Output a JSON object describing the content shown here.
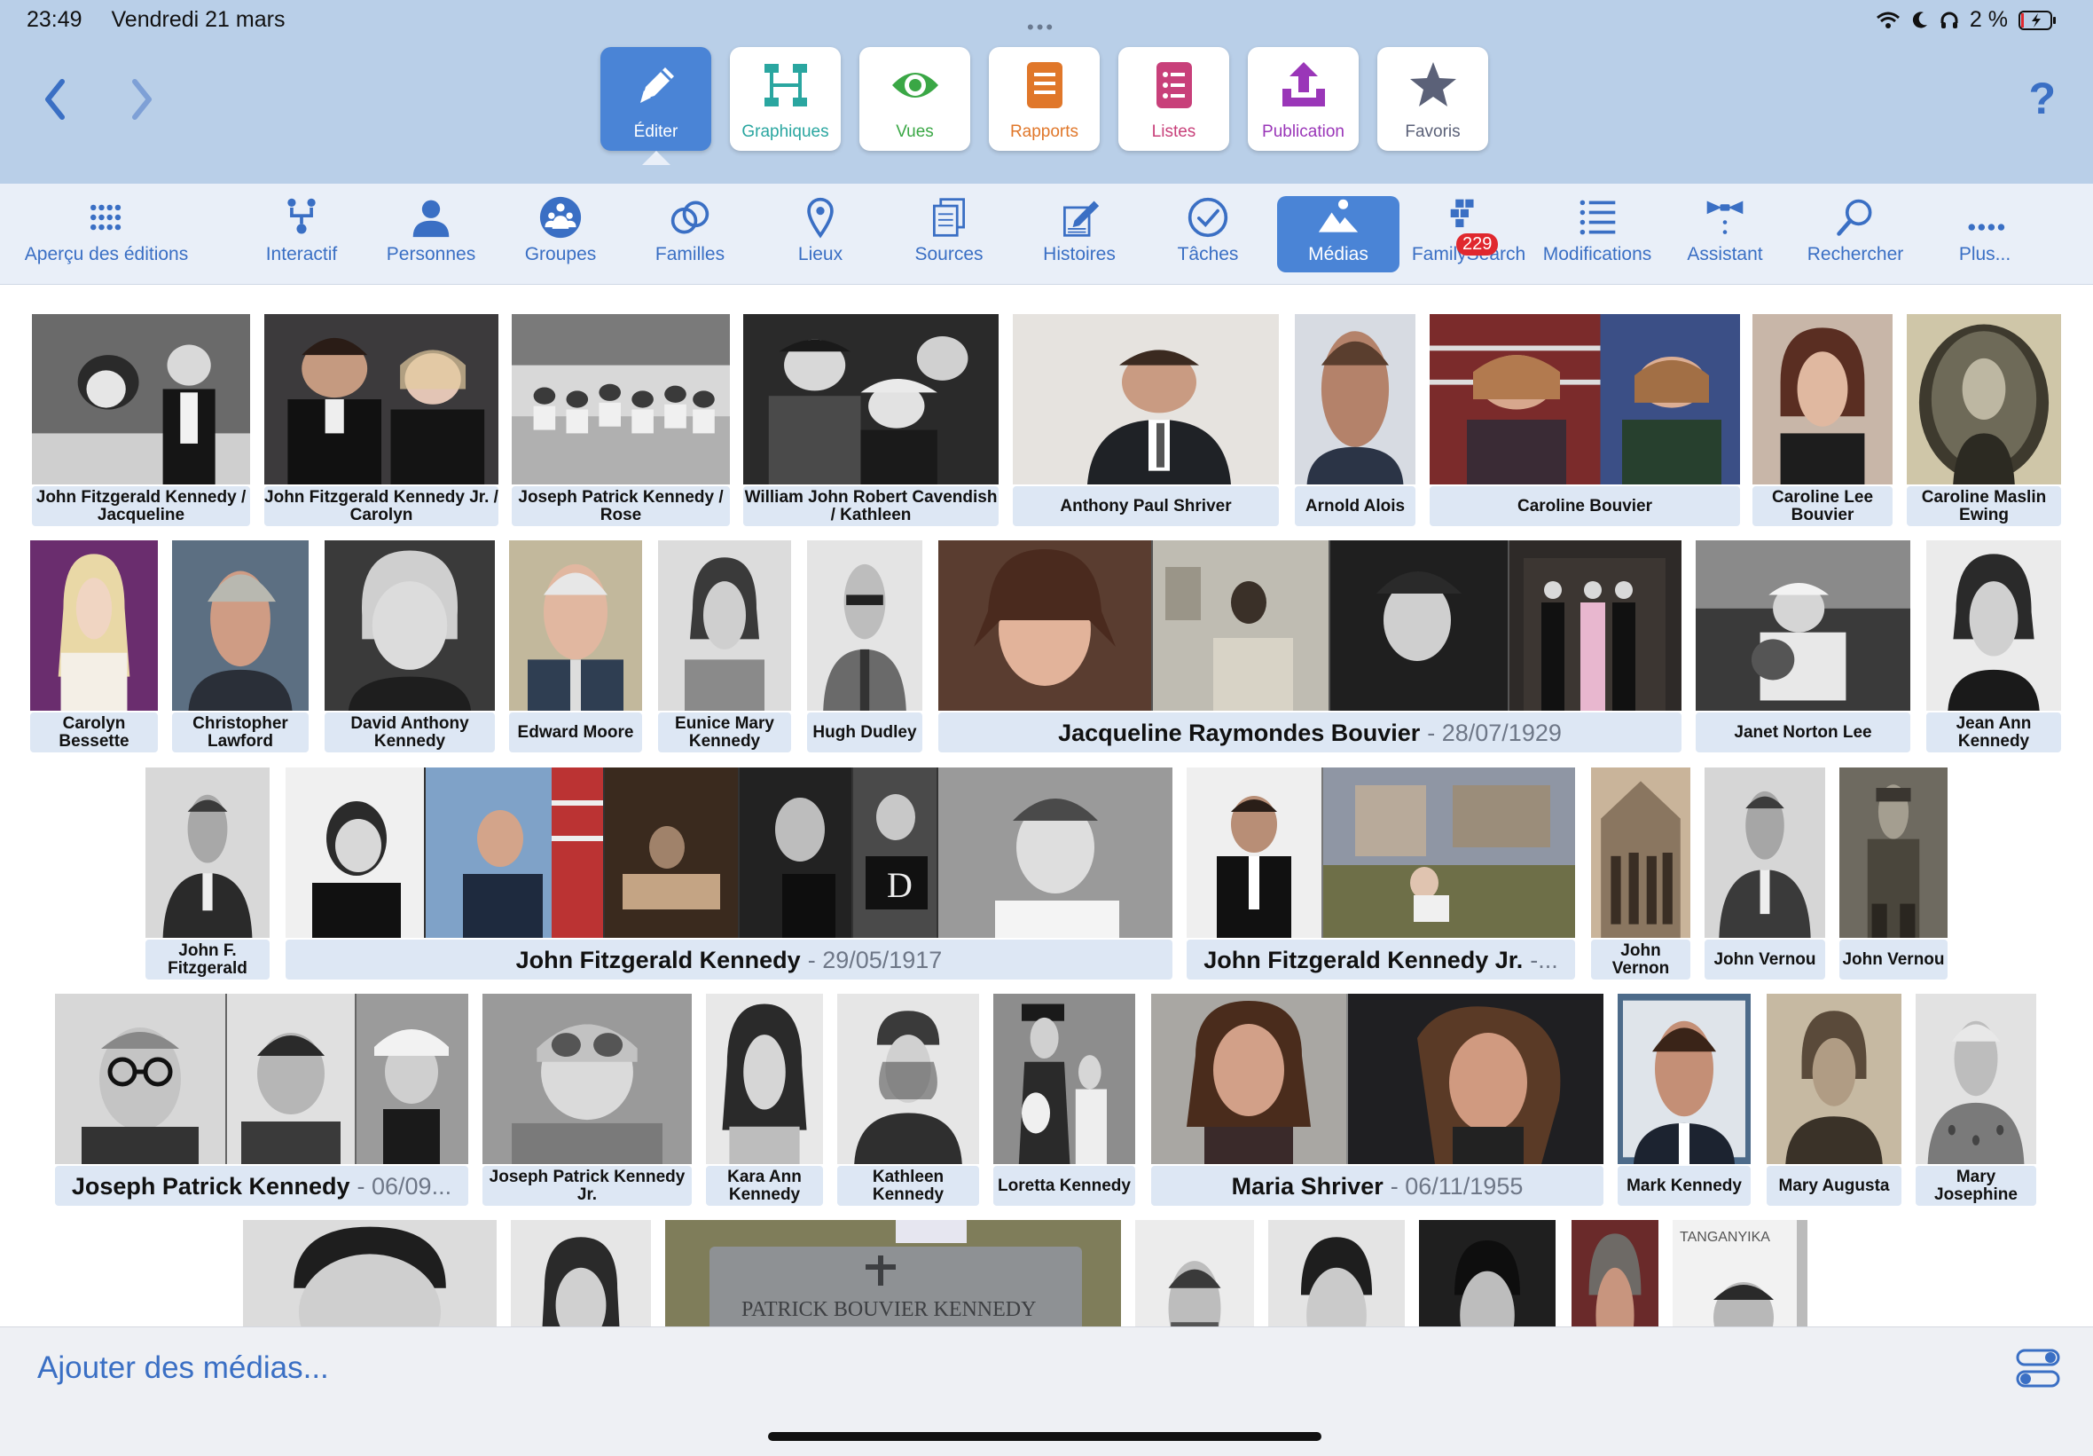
{
  "status": {
    "time": "23:49",
    "date": "Vendredi 21 mars",
    "battery": "2 %"
  },
  "help_label": "?",
  "modes": [
    {
      "label": "Éditer",
      "icon": "pencil-icon",
      "color": "#ffffff"
    },
    {
      "label": "Graphiques",
      "icon": "chart-tree-icon",
      "color": "#2aa6a0"
    },
    {
      "label": "Vues",
      "icon": "eye-icon",
      "color": "#3aa745"
    },
    {
      "label": "Rapports",
      "icon": "report-icon",
      "color": "#e0772a"
    },
    {
      "label": "Listes",
      "icon": "list-icon",
      "color": "#c8407a"
    },
    {
      "label": "Publication",
      "icon": "upload-icon",
      "color": "#9a36b8"
    },
    {
      "label": "Favoris",
      "icon": "star-icon",
      "color": "#5b6178"
    }
  ],
  "functions": [
    {
      "label": "Aperçu des éditions",
      "icon": "grid-dots-icon"
    },
    {
      "label": "Interactif",
      "icon": "tree-icon"
    },
    {
      "label": "Personnes",
      "icon": "person-icon"
    },
    {
      "label": "Groupes",
      "icon": "group-icon"
    },
    {
      "label": "Familles",
      "icon": "rings-icon"
    },
    {
      "label": "Lieux",
      "icon": "pin-icon"
    },
    {
      "label": "Sources",
      "icon": "documents-icon"
    },
    {
      "label": "Histoires",
      "icon": "story-icon"
    },
    {
      "label": "Tâches",
      "icon": "check-icon"
    },
    {
      "label": "Médias",
      "icon": "media-icon"
    },
    {
      "label": "FamilySearch",
      "icon": "familysearch-icon",
      "badge": "229"
    },
    {
      "label": "Modifications",
      "icon": "changes-icon"
    },
    {
      "label": "Assistant",
      "icon": "bowtie-icon"
    },
    {
      "label": "Rechercher",
      "icon": "search-icon"
    },
    {
      "label": "Plus...",
      "icon": "more-icon"
    }
  ],
  "media": {
    "row1": [
      "John Fitzgerald Kennedy / Jacqueline",
      "John Fitzgerald Kennedy Jr. / Carolyn",
      "Joseph Patrick Kennedy / Rose",
      "William John Robert Cavendish / Kathleen",
      "Anthony Paul Shriver",
      "Arnold Alois",
      "Caroline Bouvier",
      "Caroline Lee Bouvier",
      "Caroline Maslin Ewing"
    ],
    "row2": [
      "Carolyn Bessette",
      "Christopher Lawford",
      "David Anthony Kennedy",
      "Edward Moore",
      "Eunice Mary Kennedy",
      "Hugh Dudley",
      "Jacqueline Raymondes Bouvier",
      "Janet Norton Lee",
      "Jean Ann Kennedy"
    ],
    "row2_dates": {
      "jacqueline": "- 28/07/1929"
    },
    "row3": [
      "John F. Fitzgerald",
      "John Fitzgerald Kennedy",
      "John Fitzgerald Kennedy Jr.",
      "John Vernon",
      "John Vernou",
      "John Vernou"
    ],
    "row3_dates": {
      "jfk": "- 29/05/1917",
      "jfkjr": "-..."
    },
    "row4": [
      "Joseph Patrick Kennedy",
      "Joseph Patrick Kennedy Jr.",
      "Kara Ann Kennedy",
      "Kathleen Kennedy",
      "Loretta Kennedy",
      "Maria Shriver",
      "Mark Kennedy",
      "Mary Augusta",
      "Mary Josephine"
    ],
    "row4_dates": {
      "joseph": "- 06/09...",
      "maria": "- 06/11/1955"
    },
    "row5": {
      "headstone_text": "PATRICK BOUVIER KENNEDY",
      "sign_text": "TANGANYIKA"
    }
  },
  "bottom": {
    "add_label": "Ajouter des médias..."
  }
}
